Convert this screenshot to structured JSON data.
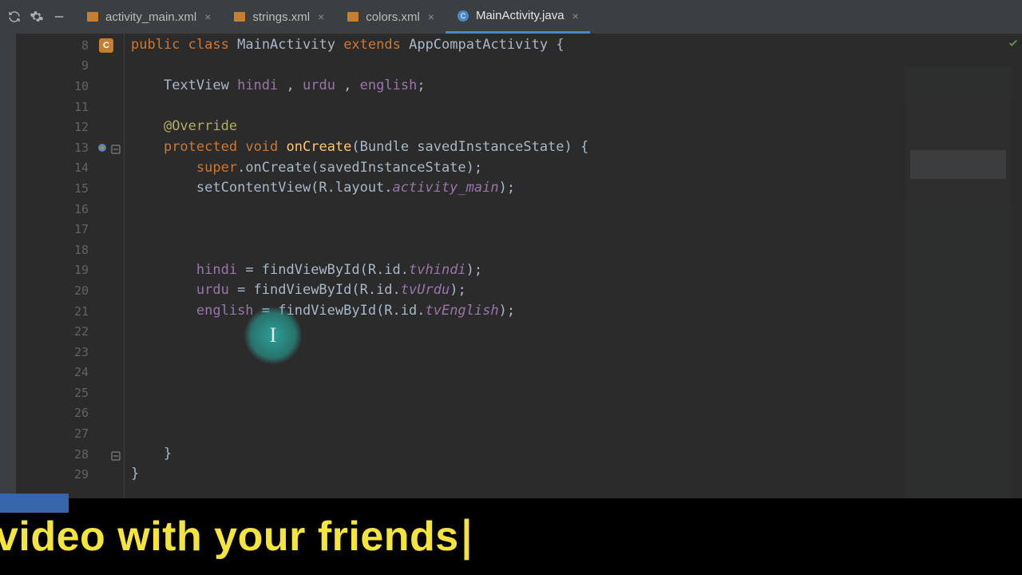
{
  "toolbar": {
    "icons": [
      "sync-icon",
      "gear-icon",
      "minimize-icon"
    ]
  },
  "tabs": [
    {
      "label": "activity_main.xml",
      "kind": "xml",
      "active": false
    },
    {
      "label": "strings.xml",
      "kind": "xml",
      "active": false
    },
    {
      "label": "colors.xml",
      "kind": "xml",
      "active": false
    },
    {
      "label": "MainActivity.java",
      "kind": "java",
      "active": true
    }
  ],
  "gutter": {
    "start": 8,
    "end": 29,
    "class_icon_line": 8,
    "breakpoint_line": 13,
    "fold_lines": [
      13,
      28
    ]
  },
  "code": {
    "l8": {
      "kw_public": "public",
      "kw_class": "class",
      "cls": "MainActivity",
      "kw_extends": "extends",
      "base": "AppCompatActivity",
      "brace": " {"
    },
    "l10": {
      "type": "TextView ",
      "f1": "hindi",
      "c1": " , ",
      "f2": "urdu",
      "c2": " , ",
      "f3": "english",
      "semi": ";"
    },
    "l12": {
      "ann": "@Override"
    },
    "l13": {
      "kw_protected": "protected",
      "sp1": " ",
      "kw_void": "void",
      "sp2": " ",
      "fn": "onCreate",
      "args": "(Bundle savedInstanceState) {"
    },
    "l14": {
      "kw_super": "super",
      "rest": ".onCreate(savedInstanceState);"
    },
    "l15": {
      "call": "setContentView(R.layout.",
      "res": "activity_main",
      "close": ");"
    },
    "l19": {
      "f": "hindi",
      "mid": " = findViewById(R.id.",
      "res": "tvhindi",
      "close": ");"
    },
    "l20": {
      "f": "urdu",
      "mid": " = findViewById(R.id.",
      "res": "tvUrdu",
      "close": ");"
    },
    "l21": {
      "f": "english",
      "mid": " = findViewById(R.id.",
      "res": "tvEnglish",
      "close": ");"
    },
    "l28": {
      "brace": "}"
    },
    "l29": {
      "brace": "}"
    }
  },
  "cursor": {
    "glyph": "I"
  },
  "caption": {
    "text": "video with your friends",
    "caret": "|"
  },
  "colors": {
    "editor_bg": "#2b2b2b",
    "panel_bg": "#3c3f41",
    "keyword": "#cc7832",
    "field": "#9876aa",
    "method": "#ffc66d",
    "annotation": "#b3ae60",
    "text": "#a9b7c6",
    "tab_underline": "#4a88c7",
    "caption_yellow": "#f5e53a",
    "cursor_teal": "#2aa198"
  }
}
